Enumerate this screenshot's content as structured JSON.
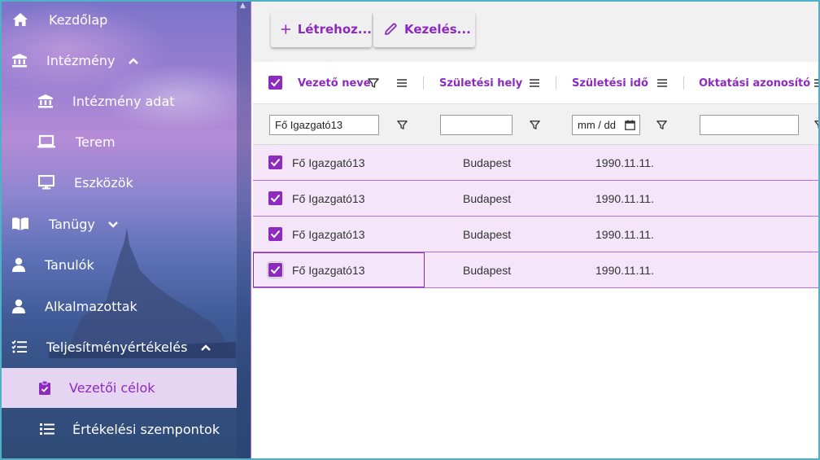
{
  "sidebar": {
    "items": [
      {
        "label": "Kezdőlap",
        "icon": "home-icon"
      },
      {
        "label": "Intézmény",
        "icon": "institution-icon",
        "expanded": true
      },
      {
        "label": "Intézmény adat",
        "icon": "institution-icon"
      },
      {
        "label": "Terem",
        "icon": "laptop-icon"
      },
      {
        "label": "Eszközök",
        "icon": "monitor-icon"
      },
      {
        "label": "Tanügy",
        "icon": "book-icon",
        "expanded": false
      },
      {
        "label": "Tanulók",
        "icon": "person-icon"
      },
      {
        "label": "Alkalmazottak",
        "icon": "person-icon"
      },
      {
        "label": "Teljesítményértékelés",
        "icon": "checklist-icon",
        "expanded": true
      },
      {
        "label": "Vezetői célok",
        "icon": "clipboard-check-icon",
        "active": true
      },
      {
        "label": "Értékelési szempontok",
        "icon": "list-icon"
      }
    ]
  },
  "toolbar": {
    "create_label": "Létrehoz...",
    "manage_label": "Kezelés..."
  },
  "table": {
    "columns": [
      {
        "label": "Vezető neve"
      },
      {
        "label": "Születési hely"
      },
      {
        "label": "Születési idő"
      },
      {
        "label": "Oktatási azonosító"
      }
    ],
    "filters": {
      "name_value": "Fő Igazgató13",
      "place_value": "",
      "date_placeholder": "mm / dd",
      "id_value": ""
    },
    "rows": [
      {
        "name": "Fő Igazgató13",
        "place": "Budapest",
        "date": "1990.11.11.",
        "checked": true
      },
      {
        "name": "Fő Igazgató13",
        "place": "Budapest",
        "date": "1990.11.11.",
        "checked": true
      },
      {
        "name": "Fő Igazgató13",
        "place": "Budapest",
        "date": "1990.11.11.",
        "checked": true
      },
      {
        "name": "Fő Igazgató13",
        "place": "Budapest",
        "date": "1990.11.11.",
        "checked": true
      }
    ]
  },
  "colors": {
    "accent": "#8c2bbd",
    "row_highlight": "#f4e6f8",
    "active_nav": "#e6d4f3"
  }
}
